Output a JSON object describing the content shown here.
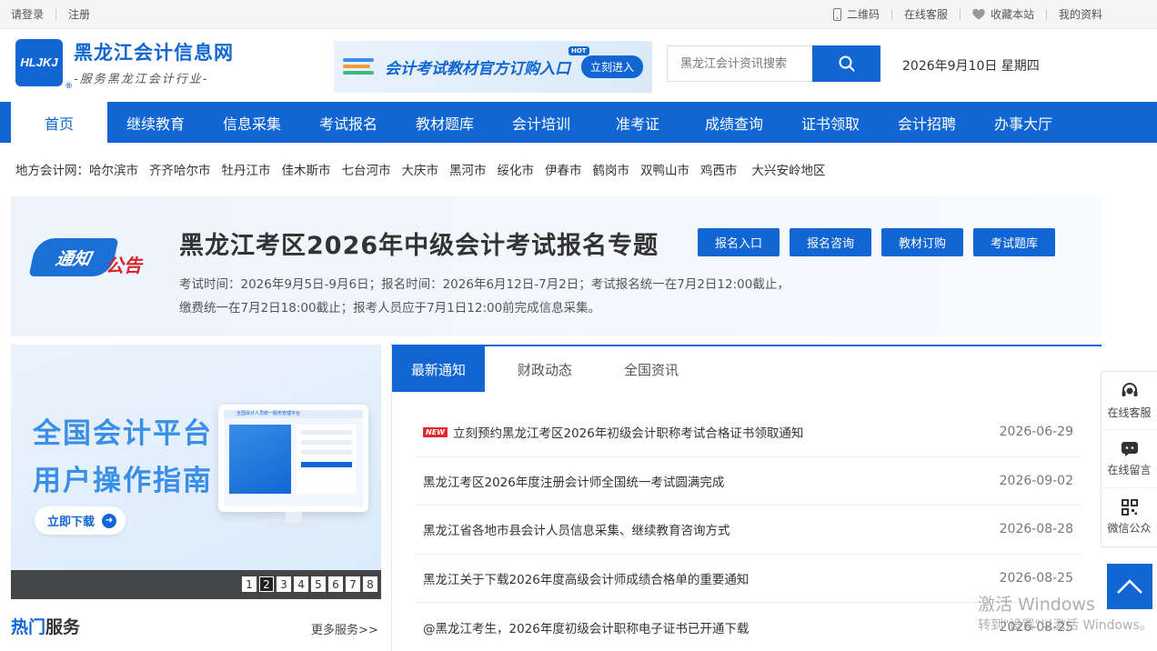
{
  "topbar": {
    "login": "请登录",
    "register": "注册",
    "qrcode": "二维码",
    "service": "在线客服",
    "favorite": "收藏本站",
    "profile": "我的资料"
  },
  "logo": {
    "mark": "HLJKJ",
    "reg": "®",
    "title": "黑龙江会计信息网",
    "subtitle": "-服务黑龙江会计行业-"
  },
  "ad": {
    "text": "会计考试教材官方订购入口",
    "hot": "HOT",
    "button": "立刻进入"
  },
  "search": {
    "placeholder": "黑龙江会计资讯搜索"
  },
  "date": "2026年9月10日 星期四",
  "nav": [
    "首页",
    "继续教育",
    "信息采集",
    "考试报名",
    "教材题库",
    "会计培训",
    "准考证",
    "成绩查询",
    "证书领取",
    "会计招聘",
    "办事大厅"
  ],
  "local": {
    "label": "地方会计网：",
    "cities": [
      "哈尔滨市",
      "齐齐哈尔市",
      "牡丹江市",
      "佳木斯市",
      "七台河市",
      "大庆市",
      "黑河市",
      "绥化市",
      "伊春市",
      "鹤岗市",
      "双鸭山市",
      "鸡西市",
      "大兴安岭地区"
    ]
  },
  "notice": {
    "badge_a": "通知",
    "badge_b": "公告",
    "title": "黑龙江考区2026年中级会计考试报名专题",
    "buttons": [
      "报名入口",
      "报名咨询",
      "教材订购",
      "考试题库"
    ],
    "line1": "考试时间：2026年9月5日-9月6日；报名时间：2026年6月12日-7月2日；考试报名统一在7月2日12:00截止，",
    "line2": "缴费统一在7月2日18:00截止；报考人员应于7月1日12:00前完成信息采集。"
  },
  "slider": {
    "title_1": "全国会计平台",
    "title_2": "用户操作指南",
    "download": "立即下载",
    "screen_header": "全国会计人员统一服务管理平台",
    "pages": [
      "1",
      "2",
      "3",
      "4",
      "5",
      "6",
      "7",
      "8"
    ],
    "active_page": "2"
  },
  "hot": {
    "title_a": "热门",
    "title_b": "服务",
    "more": "更多服务>>"
  },
  "news": {
    "tabs": [
      "最新通知",
      "财政动态",
      "全国资讯"
    ],
    "new_tag": "NEW",
    "items": [
      {
        "title": "立刻预约黑龙江考区2026年初级会计职称考试合格证书领取通知",
        "date": "2026-06-29"
      },
      {
        "title": "黑龙江考区2026年度注册会计师全国统一考试圆满完成",
        "date": "2026-09-02"
      },
      {
        "title": "黑龙江省各地市县会计人员信息采集、继续教育咨询方式",
        "date": "2026-08-28"
      },
      {
        "title": "黑龙江关于下载2026年度高级会计师成绩合格单的重要通知",
        "date": "2026-08-25"
      },
      {
        "title": "@黑龙江考生，2026年度初级会计职称电子证书已开通下载",
        "date": "2026-08-25"
      }
    ]
  },
  "float": {
    "service": "在线客服",
    "message": "在线留言",
    "wechat": "微信公众"
  },
  "watermark": {
    "line1": "激活 Windows",
    "line2": "转到\"设置\"以激活 Windows。"
  },
  "colors": {
    "primary": "#1166d3",
    "new_tag": "#e2272c",
    "badge_red": "#d9262b"
  }
}
